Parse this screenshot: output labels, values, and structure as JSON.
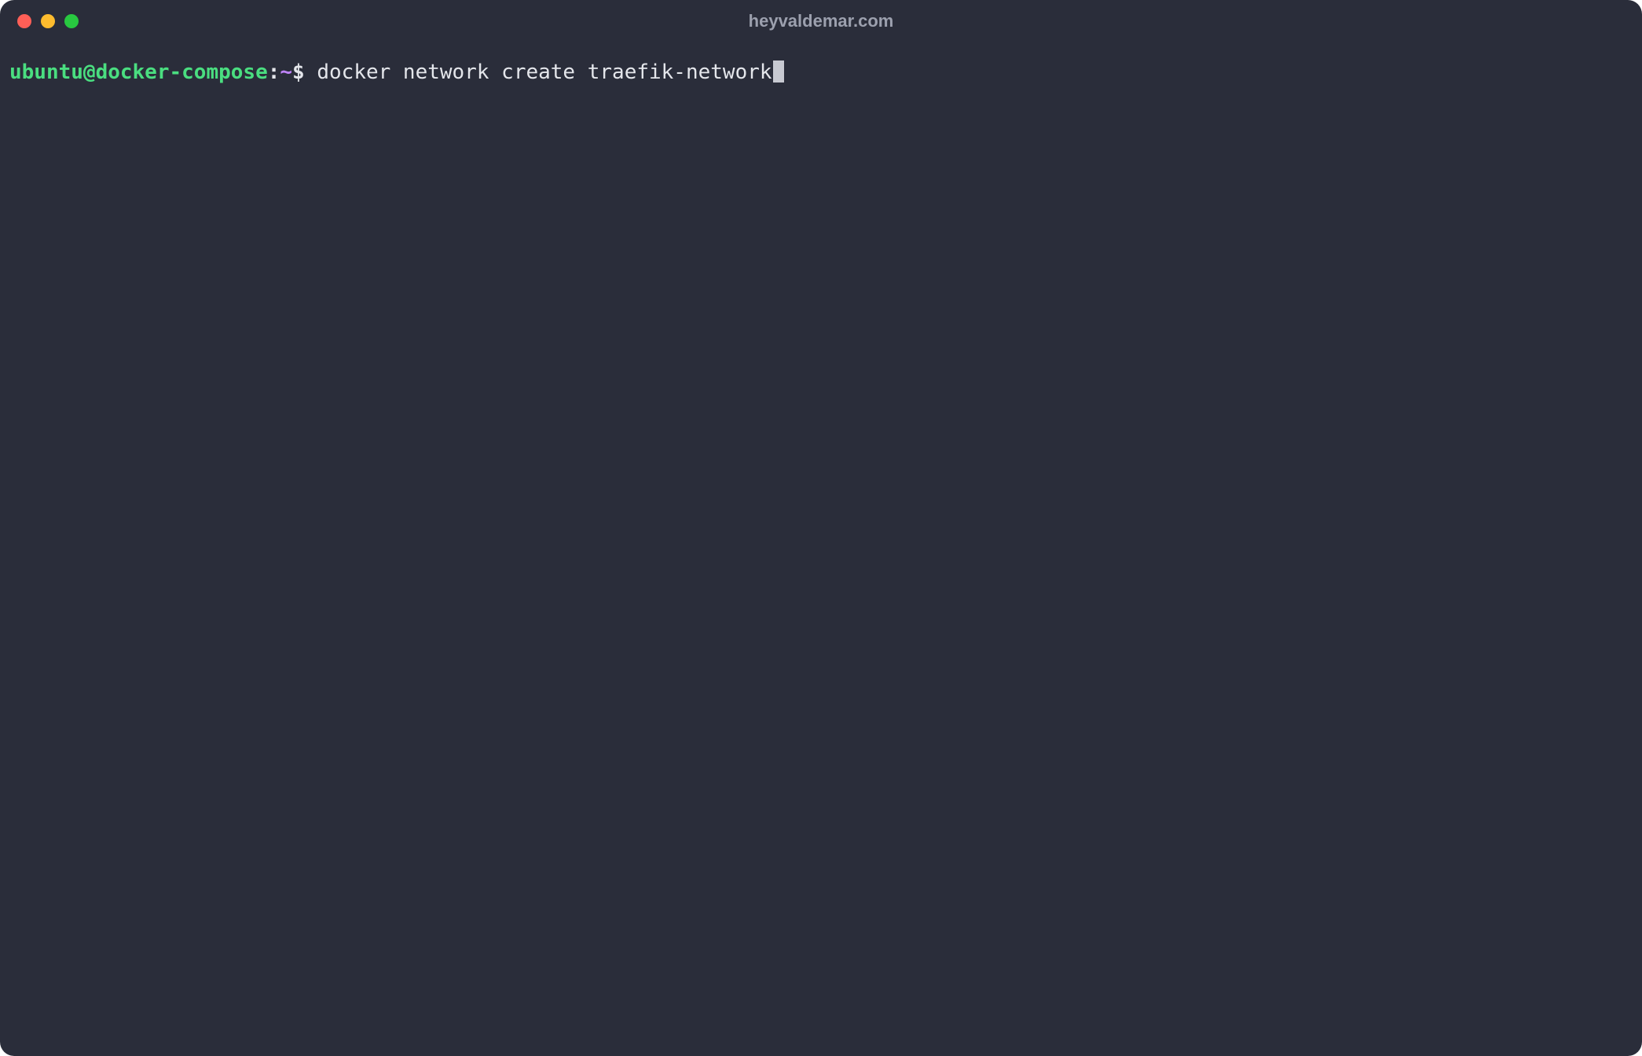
{
  "window": {
    "title": "heyvaldemar.com"
  },
  "prompt": {
    "user_host": "ubuntu@docker-compose",
    "colon": ":",
    "path": "~",
    "symbol": "$"
  },
  "command": {
    "text": "docker network create traefik-network"
  }
}
